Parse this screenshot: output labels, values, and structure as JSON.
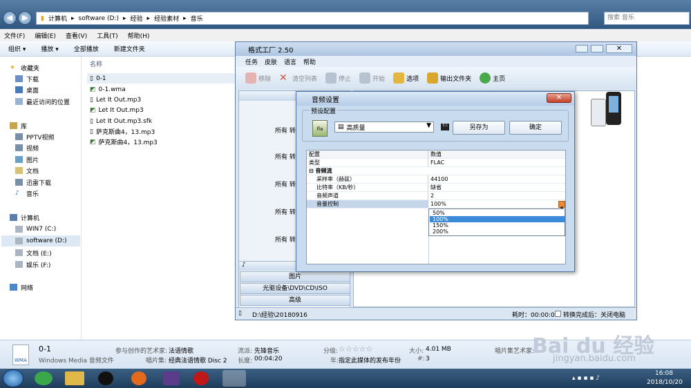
{
  "explorer": {
    "breadcrumb": [
      "计算机",
      "software (D:)",
      "经验",
      "经验素材",
      "音乐"
    ],
    "search_placeholder": "搜索 音乐",
    "menu": [
      "文件(F)",
      "编辑(E)",
      "查看(V)",
      "工具(T)",
      "帮助(H)"
    ],
    "toolbar": [
      "组织 ▾",
      "播放 ▾",
      "全部播放",
      "新建文件夹"
    ],
    "nav": {
      "favorites": "收藏夹",
      "fav_items": [
        "下载",
        "桌面",
        "最近访问的位置"
      ],
      "library": "库",
      "lib_items": [
        "PPTV视频",
        "视频",
        "图片",
        "文档",
        "迅雷下载",
        "音乐"
      ],
      "computer": "计算机",
      "drives": [
        "WIN7 (C:)",
        "software (D:)",
        "文档 (E:)",
        "娱乐 (F:)"
      ],
      "network": "网络"
    },
    "column_name": "名称",
    "files": [
      "0-1",
      "0-1.wma",
      "Let It Out.mp3",
      "Let It Out.mp3",
      "Let It Out.mp3.sfk",
      "萨克斯曲4，13.mp3",
      "萨克斯曲4，13.mp3"
    ],
    "status": {
      "name": "0-1",
      "type": "Windows Media 音频文件",
      "artist_label": "参与创作的艺术家:",
      "artist": "法语情歌",
      "album_label": "唱片集:",
      "album": "经典法语情歌 Disc 2",
      "genre_label": "流派:",
      "genre": "先锋音乐",
      "length_label": "长度:",
      "length": "00:04:20",
      "rating_label": "分级:",
      "rating": "☆☆☆☆☆",
      "year_label": "年:",
      "year": "指定此媒体的发布年份",
      "size_label": "大小:",
      "size": "4.01 MB",
      "track_label": "#:",
      "track": "3",
      "album_artist_label": "唱片集艺术家:",
      "wma": "WMA"
    },
    "clock": {
      "time": "16:08",
      "date": "2018/10/20"
    }
  },
  "ff": {
    "title": "格式工厂 2.50",
    "menu": [
      "任务",
      "皮肤",
      "语言",
      "帮助"
    ],
    "toolbar": [
      "移除",
      "清空列表",
      "停止",
      "开始",
      "选项",
      "输出文件夹",
      "主页"
    ],
    "convert_label": "所有  转换",
    "categories": [
      "图片",
      "光驱设备\\DVD\\CD\\ISO",
      "高级"
    ],
    "status_path": "D:\\经验\\20180916",
    "elapsed": "耗时：00:00:00",
    "after_done": "转换完成后：关闭电脑"
  },
  "dialog": {
    "title": "音频设置",
    "preset_label": "预设配置",
    "preset_value": "高质量",
    "saveas": "另存为",
    "ok": "确定",
    "col_config": "配置",
    "col_value": "数值",
    "rows": [
      [
        "类型",
        "FLAC"
      ],
      [
        "音频流",
        ""
      ],
      [
        "采样率（赫兹）",
        "44100"
      ],
      [
        "比特率（KB/秒）",
        "缺省"
      ],
      [
        "音频声道",
        "2"
      ],
      [
        "音量控制",
        "100%"
      ]
    ],
    "dropdown_options": [
      "50%",
      "100%",
      "150%",
      "200%"
    ],
    "selected_option": "100%"
  },
  "watermark": {
    "brand": "Bai du 经验",
    "url": "jingyan.baidu.com"
  }
}
